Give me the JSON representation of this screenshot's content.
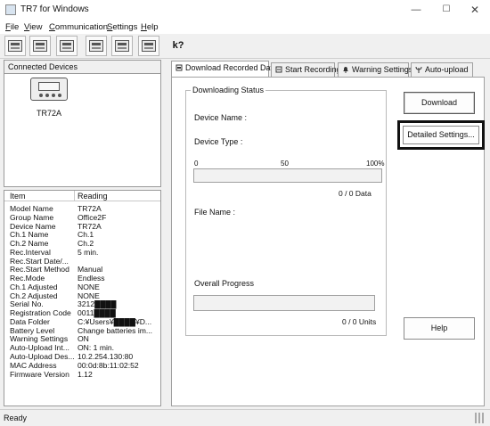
{
  "window": {
    "title": "TR7 for Windows",
    "minimize": "—",
    "maximize": "☐",
    "close": "✕"
  },
  "menu": {
    "file": "File",
    "view": "View",
    "communication": "Communication",
    "settings": "Settings",
    "help": "Help"
  },
  "toolbar": {
    "help_glyph": "k?"
  },
  "devices": {
    "header": "Connected Devices",
    "items": [
      {
        "label": "TR72A"
      }
    ]
  },
  "properties": {
    "col_item": "Item",
    "col_reading": "Reading",
    "rows": [
      {
        "item": "Model Name",
        "reading": "TR72A"
      },
      {
        "item": "Group Name",
        "reading": "Office2F"
      },
      {
        "item": "Device Name",
        "reading": "TR72A"
      },
      {
        "item": "Ch.1 Name",
        "reading": "Ch.1"
      },
      {
        "item": "Ch.2 Name",
        "reading": "Ch.2"
      },
      {
        "item": "Rec.Interval",
        "reading": "5 min."
      },
      {
        "item": "Rec.Start Date/...",
        "reading": ""
      },
      {
        "item": "Rec.Start Method",
        "reading": "Manual"
      },
      {
        "item": "Rec.Mode",
        "reading": "Endless"
      },
      {
        "item": "Ch.1 Adjusted",
        "reading": "NONE"
      },
      {
        "item": "Ch.2 Adjusted",
        "reading": "NONE"
      },
      {
        "item": "Serial No.",
        "reading": "3212████"
      },
      {
        "item": "Registration Code",
        "reading": "0011████"
      },
      {
        "item": "Data Folder",
        "reading": "C:¥Users¥████¥D..."
      },
      {
        "item": "Battery Level",
        "reading": "Change batteries im..."
      },
      {
        "item": "Warning Settings",
        "reading": "ON"
      },
      {
        "item": "Auto-Upload Int...",
        "reading": "ON: 1 min."
      },
      {
        "item": "Auto-Upload Des...",
        "reading": "10.2.254.130:80"
      },
      {
        "item": "MAC Address",
        "reading": "00:0d:8b:11:02:52"
      },
      {
        "item": "Firmware Version",
        "reading": "1.12"
      }
    ]
  },
  "tabs": {
    "download": "Download Recorded Data",
    "start": "Start Recording",
    "warning": "Warning Settings",
    "auto": "Auto-upload"
  },
  "download_panel": {
    "group_title": "Downloading Status",
    "device_name_label": "Device Name :",
    "device_type_label": "Device Type :",
    "scale_min": "0",
    "scale_mid": "50",
    "scale_max": "100%",
    "progress_fraction": 0,
    "data_count": "0 / 0 Data",
    "file_name_label": "File Name :",
    "overall_label": "Overall Progress",
    "overall_fraction": 0,
    "units_count": "0 / 0 Units"
  },
  "buttons": {
    "download": "Download",
    "detailed_settings": "Detailed Settings...",
    "help": "Help"
  },
  "statusbar": {
    "text": "Ready"
  },
  "colors": {
    "window_bg": "#f0f0f0",
    "panel_bg": "#ffffff",
    "highlight_border": "#111111"
  }
}
